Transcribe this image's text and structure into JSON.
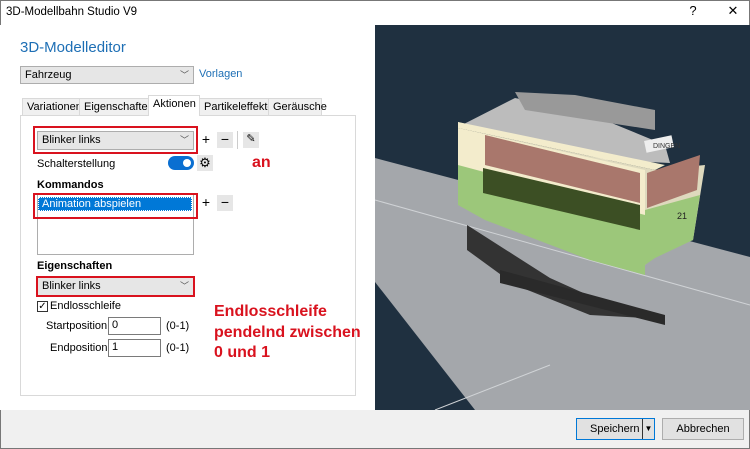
{
  "window": {
    "title": "3D-Modellbahn Studio V9",
    "help": "?",
    "close": "✕"
  },
  "editor": {
    "title": "3D-Modelleditor",
    "type_select": "Fahrzeug",
    "templates_link": "Vorlagen"
  },
  "tabs": [
    {
      "label": "Variationen"
    },
    {
      "label": "Eigenschaften"
    },
    {
      "label": "Aktionen",
      "active": true
    },
    {
      "label": "Partikeleffekte"
    },
    {
      "label": "Geräusche"
    }
  ],
  "actions": {
    "action_select": "Blinker links",
    "add": "+",
    "remove": "−",
    "switch_label": "Schalterstellung",
    "switch_on": true,
    "commands_heading": "Kommandos",
    "commands": [
      "Animation abspielen"
    ],
    "properties_heading": "Eigenschaften",
    "property_select": "Blinker links",
    "loop_label": "Endlosschleife",
    "loop_checked": true,
    "start_label": "Startposition:",
    "start_value": "0",
    "start_range": "(0-1)",
    "end_label": "Endposition:",
    "end_value": "1",
    "end_range": "(0-1)"
  },
  "annotations": {
    "switch_note": "an",
    "loop_note": [
      "Endlosschleife",
      "pendelnd zwischen",
      "0 und 1"
    ]
  },
  "viewport": {
    "tram_number": "21",
    "tram_sign": "DINGEN"
  },
  "footer": {
    "save": "Speichern",
    "cancel": "Abbrechen"
  },
  "colors": {
    "accent": "#1e6fb5",
    "annotation": "#d9121e",
    "viewport_bg": "#1f3040"
  }
}
